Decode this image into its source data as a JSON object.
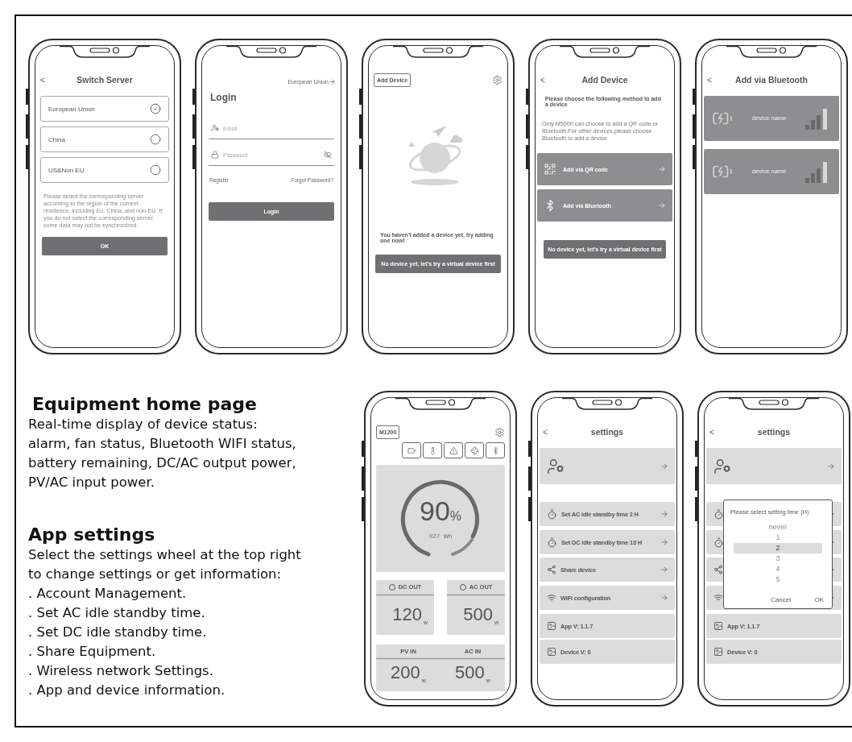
{
  "screens_top": [
    {
      "kind": "switch_server",
      "back": "<",
      "title": "Switch Server",
      "options": [
        {
          "label": "European Union",
          "selected": true
        },
        {
          "label": "China",
          "selected": false
        },
        {
          "label": "US&Non EU",
          "selected": false
        }
      ],
      "note": "Please select the corresponding server according to the region of the current residence, including Eu, China, and non-EU. If you do not select the corresponding server, some data may not be synchronized.",
      "button": "OK"
    },
    {
      "kind": "login",
      "region": "European Union",
      "title": "Login",
      "email_placeholder": "Email",
      "password_placeholder": "Password",
      "register": "Register",
      "forgot": "Forgot Password?",
      "button": "Login"
    },
    {
      "kind": "empty_devices",
      "add_button": "Add Device",
      "message": "You haven't added a device yet, try adding one now!",
      "button": "No device yet, let's try a virtual device first"
    },
    {
      "kind": "add_device",
      "back": "<",
      "title": "Add Device",
      "heading": "Please choose the following method to add a device",
      "note": "Only M5000 can choose to add a QR code or Bluetooth.For other devices,please choose Bluetooth to add a device",
      "methods": [
        {
          "kind": "qr",
          "label": "Add via QR code"
        },
        {
          "kind": "bluetooth",
          "label": "Add via Bluetooth"
        }
      ],
      "button": "No device yet, let's try a virtual device first"
    },
    {
      "kind": "bluetooth_list",
      "back": "<",
      "title": "Add via Bluetooth",
      "devices": [
        {
          "name": "device name"
        },
        {
          "name": "device name"
        }
      ]
    }
  ],
  "descriptions": [
    {
      "heading": "Equipment home page",
      "text": "Real-time display of device status:\nalarm, fan status, Bluetooth WIFI status,\nbattery remaining, DC/AC output power,\nPV/AC input power."
    },
    {
      "heading": "App settings",
      "text": "Select the settings wheel at the top right\nto change settings or get information:",
      "items": [
        ". Account Management.",
        ". Set AC idle standby time.",
        ". Set DC idle standby time.",
        ". Share Equipment.",
        ". Wireless network Settings.",
        ". App and device information."
      ]
    }
  ],
  "screens_bottom": [
    {
      "kind": "home",
      "model": "M1200",
      "battery": {
        "percent": "90",
        "percent_unit": "%",
        "energy": "927",
        "energy_unit": "Wh"
      },
      "outputs": [
        {
          "label": "DC OUT",
          "on": false,
          "value": "120",
          "unit": "w"
        },
        {
          "label": "AC OUT",
          "on": false,
          "value": "500",
          "unit": "w"
        }
      ],
      "inputs": [
        {
          "label": "PV IN",
          "value": "200",
          "unit": "w"
        },
        {
          "label": "AC IN",
          "value": "500",
          "unit": "w"
        }
      ]
    },
    {
      "kind": "settings",
      "back": "<",
      "title": "settings",
      "rows": [
        {
          "kind": "timer",
          "label": "Set AC idle standby time 2 H"
        },
        {
          "kind": "timer",
          "label": "Set DC idle standby time 13 H"
        },
        {
          "kind": "share",
          "label": "Share device"
        },
        {
          "kind": "wifi",
          "label": "WiFi configuration"
        }
      ],
      "info": [
        "App V: 1.1.7",
        "Device V: 0"
      ]
    },
    {
      "kind": "settings",
      "back": "<",
      "title": "settings",
      "rows": [
        {
          "kind": "timer"
        },
        {
          "kind": "timer"
        },
        {
          "kind": "share"
        },
        {
          "kind": "wifi"
        }
      ],
      "info": [
        "App V: 1.1.7",
        "Device V: 0"
      ],
      "dialog": {
        "title": "Please select setting time (H)",
        "options": [
          {
            "label": "never",
            "selected": false
          },
          {
            "label": "1",
            "selected": false
          },
          {
            "label": "2",
            "selected": true
          },
          {
            "label": "3",
            "selected": false
          },
          {
            "label": "4",
            "selected": false
          },
          {
            "label": "5",
            "selected": false
          }
        ],
        "cancel": "Cancel",
        "ok": "OK"
      }
    }
  ]
}
